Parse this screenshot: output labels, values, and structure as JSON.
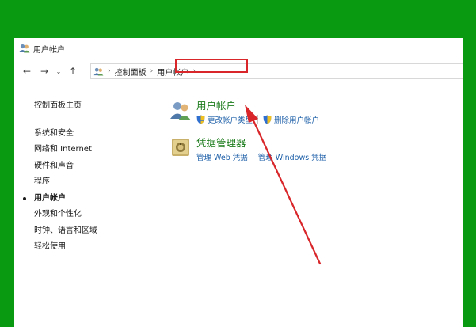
{
  "window": {
    "title": "用户帐户"
  },
  "addressbar": {
    "path": [
      "控制面板",
      "用户帐户"
    ]
  },
  "sidebar": {
    "home": "控制面板主页",
    "items": [
      {
        "label": "系统和安全"
      },
      {
        "label": "网络和 Internet"
      },
      {
        "label": "硬件和声音"
      },
      {
        "label": "程序"
      },
      {
        "label": "用户帐户",
        "active": true
      },
      {
        "label": "外观和个性化"
      },
      {
        "label": "时钟、语言和区域"
      },
      {
        "label": "轻松使用"
      }
    ]
  },
  "main": {
    "user_accounts": {
      "title": "用户帐户",
      "links": [
        "更改帐户类型",
        "删除用户帐户"
      ]
    },
    "credential_manager": {
      "title": "凭据管理器",
      "links": [
        "管理 Web 凭据",
        "管理 Windows 凭据"
      ]
    }
  },
  "colors": {
    "background": "#0a9a12",
    "link": "#1d5fa8",
    "category_title": "#1e7d1e",
    "annotation": "#d8262a"
  }
}
